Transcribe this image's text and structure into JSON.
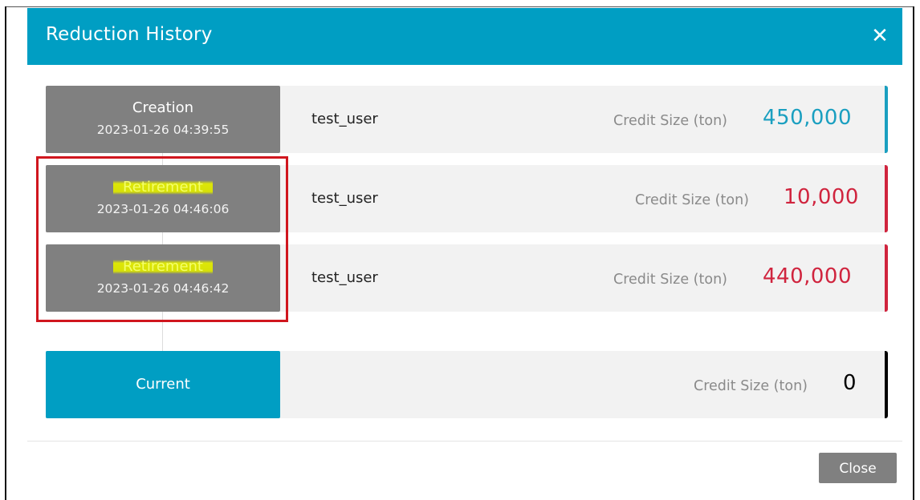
{
  "modal": {
    "title": "Reduction History",
    "close_icon": "close-icon"
  },
  "history": [
    {
      "event": "Creation",
      "time": "2023-01-26 04:39:55",
      "user": "test_user",
      "credit_label": "Credit Size (ton)",
      "credit_value": "450,000",
      "accent": "#1a9fc0"
    },
    {
      "event": "Retirement",
      "time": "2023-01-26 04:46:06",
      "user": "test_user",
      "credit_label": "Credit Size (ton)",
      "credit_value": "10,000",
      "accent": "#d0243e"
    },
    {
      "event": "Retirement",
      "time": "2023-01-26 04:46:42",
      "user": "test_user",
      "credit_label": "Credit Size (ton)",
      "credit_value": "440,000",
      "accent": "#d0243e"
    }
  ],
  "current": {
    "label": "Current",
    "credit_label": "Credit Size (ton)",
    "credit_value": "0",
    "accent": "#000000"
  },
  "footer": {
    "close_label": "Close"
  }
}
